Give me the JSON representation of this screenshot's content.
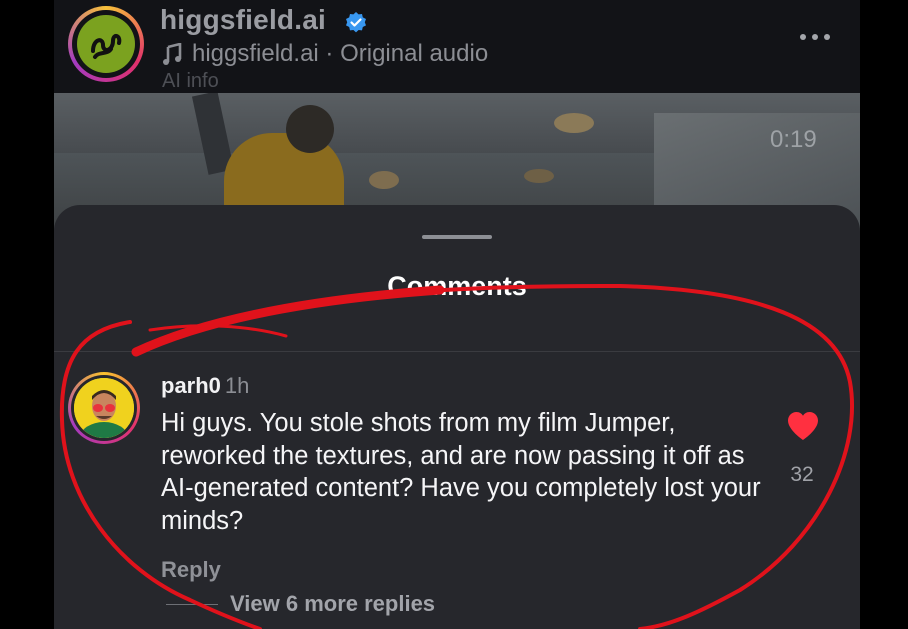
{
  "header": {
    "account_name": "higgsfield.ai",
    "audio_label": "higgsfield.ai · Original audio",
    "ai_info": "AI info"
  },
  "video": {
    "duration": "0:19"
  },
  "comments_sheet": {
    "title": "Comments",
    "comment": {
      "username": "parh0",
      "time": "1h",
      "text": "Hi guys. You stole shots from my film Jumper, reworked the textures, and are now passing it off as AI-generated content? Have you completely lost your minds?",
      "like_count": "32",
      "reply_label": "Reply",
      "view_replies_label": "View 6 more replies"
    }
  },
  "icons": {
    "verified": "verified-badge-icon",
    "music": "music-note-icon",
    "more": "more-options-icon",
    "like": "heart-icon"
  },
  "colors": {
    "sheet_bg": "#26272c",
    "verified_blue": "#3897f0",
    "heart_red": "#ff3040",
    "annotation_red": "#e0121b"
  }
}
